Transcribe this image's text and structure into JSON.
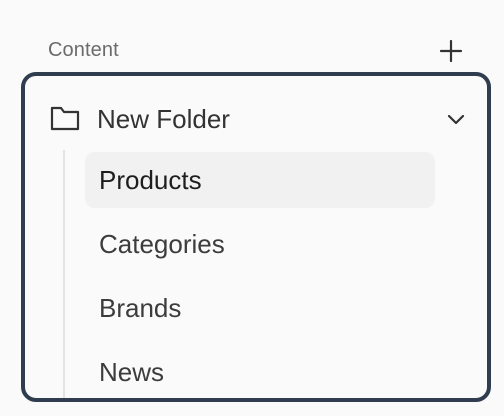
{
  "section": {
    "title": "Content",
    "add_icon": "plus-icon"
  },
  "folder": {
    "name": "New Folder",
    "icon": "folder-icon",
    "toggle_icon": "chevron-down-icon",
    "expanded": true,
    "items": [
      {
        "label": "Products",
        "active": true
      },
      {
        "label": "Categories",
        "active": false
      },
      {
        "label": "Brands",
        "active": false
      },
      {
        "label": "News",
        "active": false
      }
    ]
  },
  "colors": {
    "border": "#2f3d4e",
    "active_bg": "#f1f1f1",
    "background": "#fafafa"
  }
}
